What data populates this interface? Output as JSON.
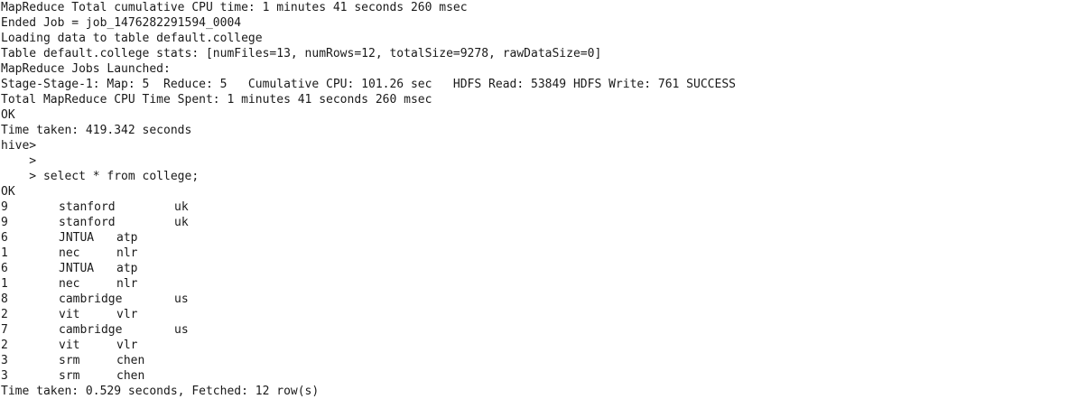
{
  "terminal": {
    "pre_lines": [
      "MapReduce Total cumulative CPU time: 1 minutes 41 seconds 260 msec",
      "Ended Job = job_1476282291594_0004",
      "Loading data to table default.college",
      "Table default.college stats: [numFiles=13, numRows=12, totalSize=9278, rawDataSize=0]",
      "MapReduce Jobs Launched:",
      "Stage-Stage-1: Map: 5  Reduce: 5   Cumulative CPU: 101.26 sec   HDFS Read: 53849 HDFS Write: 761 SUCCESS",
      "Total MapReduce CPU Time Spent: 1 minutes 41 seconds 260 msec",
      "OK",
      "Time taken: 419.342 seconds",
      "hive>",
      "    >",
      "    > select * from college;",
      "OK"
    ],
    "rows": [
      {
        "id": "9",
        "name": "stanford",
        "city": "uk"
      },
      {
        "id": "9",
        "name": "stanford",
        "city": "uk"
      },
      {
        "id": "6",
        "name": "JNTUA",
        "city": "atp"
      },
      {
        "id": "1",
        "name": "nec",
        "city": "nlr"
      },
      {
        "id": "6",
        "name": "JNTUA",
        "city": "atp"
      },
      {
        "id": "1",
        "name": "nec",
        "city": "nlr"
      },
      {
        "id": "8",
        "name": "cambridge",
        "city": "us"
      },
      {
        "id": "2",
        "name": "vit",
        "city": "vlr"
      },
      {
        "id": "7",
        "name": "cambridge",
        "city": "us"
      },
      {
        "id": "2",
        "name": "vit",
        "city": "vlr"
      },
      {
        "id": "3",
        "name": "srm",
        "city": "chen"
      },
      {
        "id": "3",
        "name": "srm",
        "city": "chen"
      }
    ],
    "footer": "Time taken: 0.529 seconds, Fetched: 12 row(s)"
  }
}
